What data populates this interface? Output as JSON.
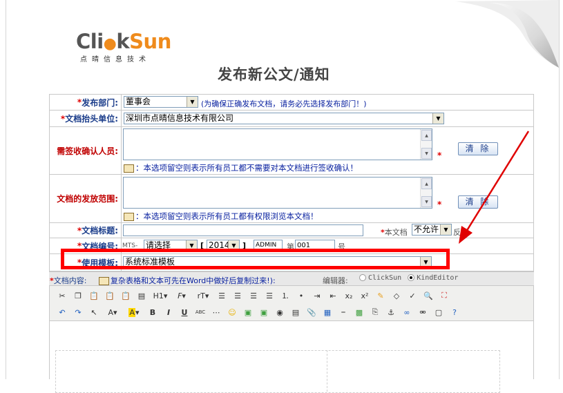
{
  "logo": {
    "part1": "Cli",
    "part2": "k",
    "part3": "Sun",
    "o_mark": "●",
    "sub": "点晴信息技术"
  },
  "title": "发布新公文/通知",
  "form": {
    "dept": {
      "label": "发布部门:",
      "value": "董事会",
      "note": "(为确保正确发布文档，请务必先选择发布部门！)"
    },
    "unit": {
      "label": "文档抬头单位:",
      "value": "深圳市点晴信息技术有限公司"
    },
    "confirm": {
      "label": "需签收确认人员:",
      "button": "清 除",
      "note": "：本选项留空则表示所有员工都不需要对本文档进行签收确认！"
    },
    "scope": {
      "label": "文档的发放范围:",
      "button": "清 除",
      "note": "：本选项留空则表示所有员工都有权限浏览本文档！"
    },
    "doc_title": {
      "label": "文档标题:",
      "value": "",
      "extra_label": "本文档",
      "extra_value": "不允许",
      "extra_tail": "反馈"
    },
    "doc_number": {
      "label": "文档编号:",
      "prefix": "MTS-",
      "select1": "请选择",
      "bracket_l": "[",
      "year": "2014",
      "bracket_r": "]",
      "admin": "ADMIN",
      "di": "第",
      "num": "001",
      "hao": "号"
    },
    "template": {
      "label": "使用模板:",
      "value": "系统标准模板"
    },
    "content": {
      "label": "文档内容:",
      "note": "复杂表格和文本可先在Word中做好后复制过来!",
      "close": "):",
      "editor_label": "编辑器:",
      "opt1": "ClickSun",
      "opt2": "KindEditor",
      "selected": "KindEditor"
    }
  },
  "star": "*",
  "toolbar": {
    "row1": [
      "cut-icon",
      "copy-icon",
      "paste-icon",
      "paste-text-icon",
      "paste-word-icon",
      "template-icon",
      "H1-",
      "F-",
      "rT-",
      "align-left-icon",
      "align-center-icon",
      "align-right-icon",
      "justify-icon",
      "ordered-list-icon",
      "unordered-list-icon",
      "indent-icon",
      "outdent-icon",
      "x₂",
      "x²",
      "clear-format-icon",
      "eraser-icon",
      "spellcheck-icon",
      "preview-icon",
      "fullscreen-icon"
    ],
    "row2": [
      "undo-icon",
      "redo-icon",
      "select-icon",
      "A-",
      "A-",
      "B",
      "I",
      "U",
      "ABC",
      "hr-icon",
      "emoticon-icon",
      "image-icon",
      "multi-image-icon",
      "flash-icon",
      "media-icon",
      "attachment-icon",
      "table-icon",
      "insert-hr-icon",
      "map-icon",
      "pagebreak-icon",
      "anchor-icon",
      "link-icon",
      "unlink-icon",
      "source-icon",
      "help-icon"
    ],
    "labels": {
      "h1": "H1",
      "f": "F",
      "rt": "rT",
      "sub": "x₂",
      "sup": "x²",
      "a": "A",
      "b": "B",
      "i": "I",
      "u": "U",
      "abc": "ABC"
    }
  },
  "colors": {
    "highlight_box": "#ff0000",
    "arrow": "#e00000",
    "label_blue": "#1a3c8a",
    "label_red": "#c00000",
    "note_blue": "#0a22a0"
  }
}
